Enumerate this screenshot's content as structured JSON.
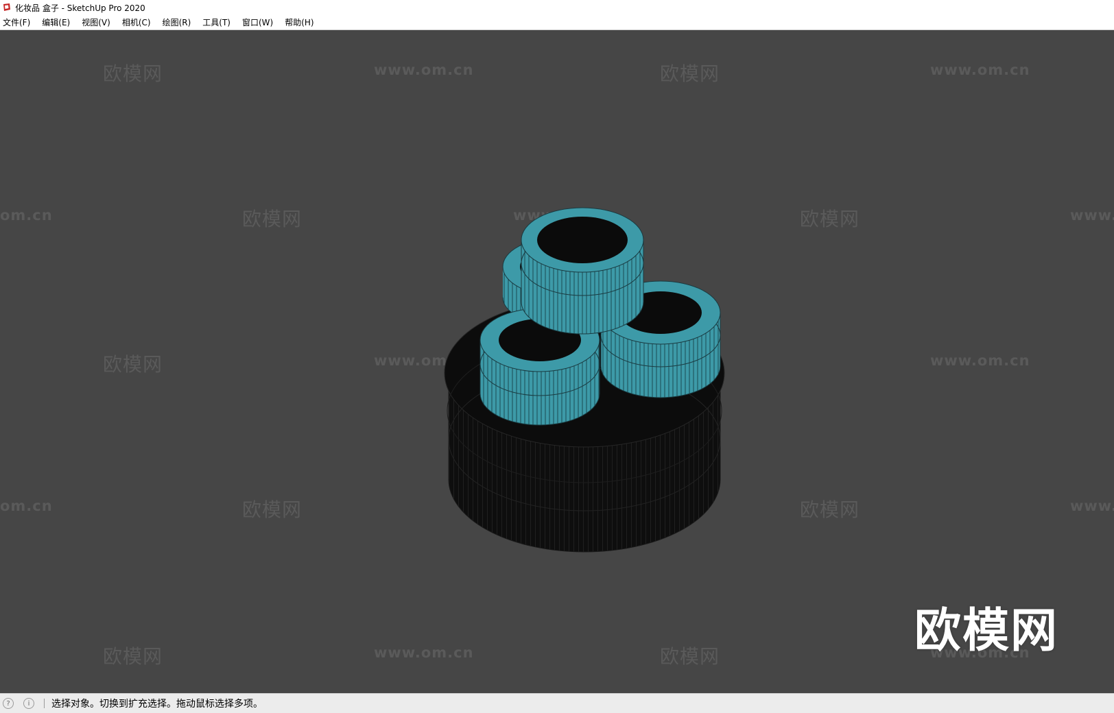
{
  "window": {
    "title": "化妆品 盒子 - SketchUp Pro 2020",
    "app_icon": "sketchup-logo-icon",
    "accent_color": "#c62828"
  },
  "menu": {
    "file": "文件(F)",
    "edit": "编辑(E)",
    "view": "视图(V)",
    "camera": "相机(C)",
    "draw": "绘图(R)",
    "tools": "工具(T)",
    "window": "窗口(W)",
    "help": "帮助(H)"
  },
  "viewport": {
    "background_color": "#464646",
    "model_colors": {
      "teal": "#3d9aa8",
      "dark": "#0e0e0e",
      "edges": "#1f1f1f"
    }
  },
  "watermark": {
    "brand": "欧模网",
    "url": "www.om.cn",
    "url_partial_left": "om.cn",
    "url_partial_right": "www.",
    "big": "欧模网"
  },
  "statusbar": {
    "geo_icon": "geo-location-icon",
    "info_icon": "info-icon",
    "message": "选择对象。切换到扩充选择。拖动鼠标选择多项。"
  }
}
